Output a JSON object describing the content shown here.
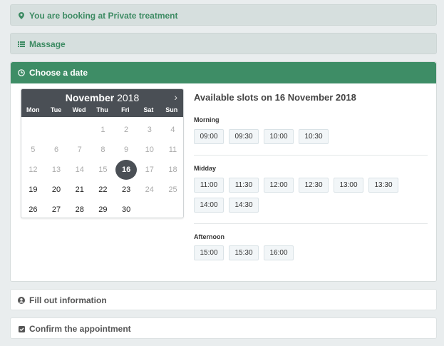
{
  "steps": {
    "booking": {
      "label": "You are booking at Private treatment",
      "icon": "map-marker-icon"
    },
    "service": {
      "label": "Massage",
      "icon": "list-icon"
    },
    "date": {
      "label": "Choose a date",
      "icon": "clock-icon"
    },
    "info": {
      "label": "Fill out information",
      "icon": "user-icon"
    },
    "confirm": {
      "label": "Confirm the appointment",
      "icon": "check-square-icon"
    }
  },
  "calendar": {
    "month": "November",
    "year": "2018",
    "next": "›",
    "dows": [
      "Mon",
      "Tue",
      "Wed",
      "Thu",
      "Fri",
      "Sat",
      "Sun"
    ],
    "weeks": [
      [
        "",
        "",
        "",
        "1",
        "2",
        "3",
        "4"
      ],
      [
        "5",
        "6",
        "7",
        "8",
        "9",
        "10",
        "11"
      ],
      [
        "12",
        "13",
        "14",
        "15",
        "16",
        "17",
        "18"
      ],
      [
        "19",
        "20",
        "21",
        "22",
        "23",
        "24",
        "25"
      ],
      [
        "26",
        "27",
        "28",
        "29",
        "30",
        "",
        ""
      ]
    ],
    "available": [
      "16",
      "19",
      "20",
      "21",
      "22",
      "23",
      "26",
      "27",
      "28",
      "29",
      "30"
    ],
    "selected": "16"
  },
  "slots": {
    "title": "Available slots on 16 November 2018",
    "morning": {
      "label": "Morning",
      "times": [
        "09:00",
        "09:30",
        "10:00",
        "10:30"
      ]
    },
    "midday": {
      "label": "Midday",
      "times": [
        "11:00",
        "11:30",
        "12:00",
        "12:30",
        "13:00",
        "13:30",
        "14:00",
        "14:30"
      ]
    },
    "afternoon": {
      "label": "Afternoon",
      "times": [
        "15:00",
        "15:30",
        "16:00"
      ]
    }
  },
  "colors": {
    "accent": "#3e8d66",
    "calendar_header": "#4a4f55"
  }
}
